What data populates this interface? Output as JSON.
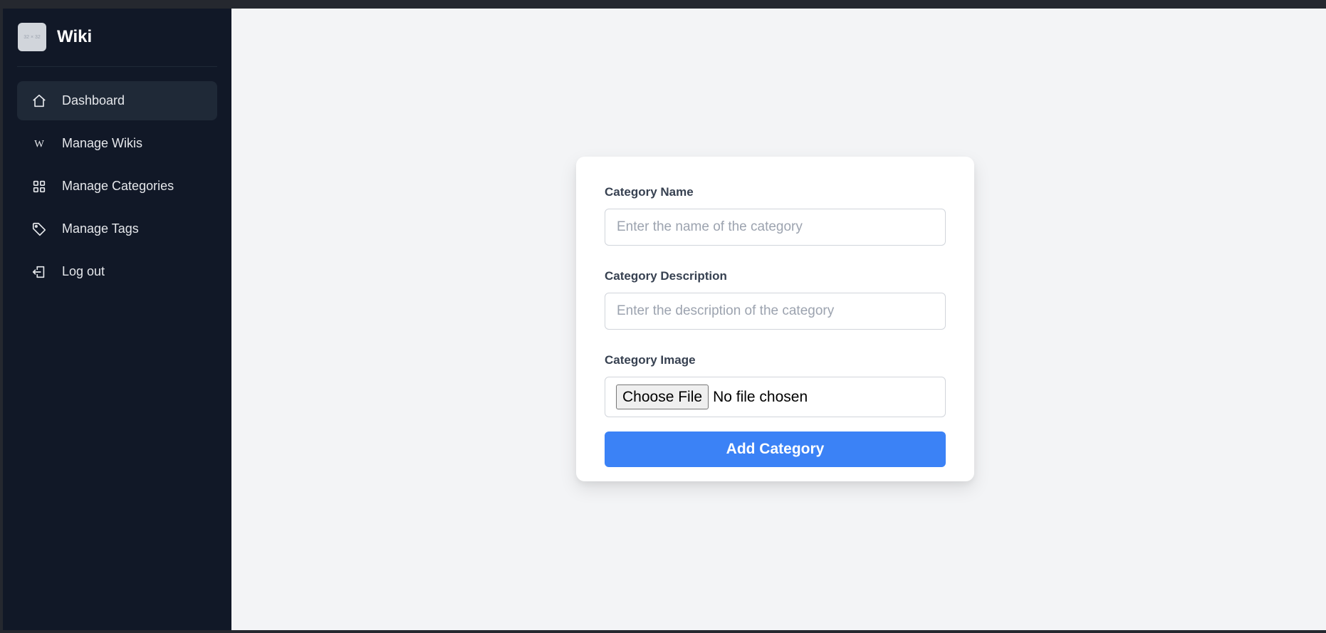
{
  "brand": {
    "logo_text": "32 × 32",
    "name": "Wiki"
  },
  "sidebar": {
    "items": [
      {
        "label": "Dashboard",
        "icon": "home-icon",
        "active": true
      },
      {
        "label": "Manage Wikis",
        "icon": "wikipedia-w-icon"
      },
      {
        "label": "Manage Categories",
        "icon": "grid-icon"
      },
      {
        "label": "Manage Tags",
        "icon": "tag-icon"
      },
      {
        "label": "Log out",
        "icon": "logout-icon"
      }
    ]
  },
  "form": {
    "name_label": "Category Name",
    "name_placeholder": "Enter the name of the category",
    "description_label": "Category Description",
    "description_placeholder": "Enter the description of the category",
    "image_label": "Category Image",
    "file_button": "Choose File",
    "file_status": "No file chosen",
    "submit_label": "Add Category"
  },
  "colors": {
    "sidebar_bg": "#111827",
    "active_item_bg": "#1f2937",
    "main_bg": "#f3f4f6",
    "primary": "#3b82f6"
  }
}
